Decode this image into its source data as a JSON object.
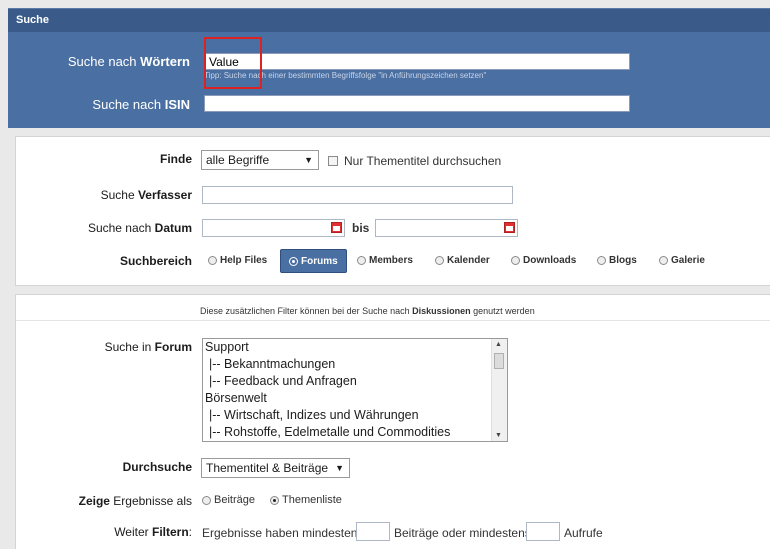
{
  "title": "Suche",
  "words": {
    "label_prefix": "Suche nach ",
    "label_bold": "Wörtern",
    "value": "Value",
    "tip": "Tipp: Suche nach einer bestimmten Begriffsfolge \"in Anführungszeichen setzen\""
  },
  "isin": {
    "label_prefix": "Suche nach ",
    "label_bold": "ISIN",
    "value": ""
  },
  "finde": {
    "label": "Finde",
    "selected": "alle Begriffe",
    "checkbox_label": "Nur Thementitel durchsuchen"
  },
  "verfasser": {
    "label_prefix": "Suche ",
    "label_bold": "Verfasser"
  },
  "datum": {
    "label_prefix": "Suche nach ",
    "label_bold": "Datum",
    "between": "bis"
  },
  "suchbereich": {
    "label": "Suchbereich",
    "options": [
      "Help Files",
      "Forums",
      "Members",
      "Kalender",
      "Downloads",
      "Blogs",
      "Galerie"
    ],
    "selected": "Forums"
  },
  "hint": {
    "prefix": "Diese zusätzlichen Filter können bei der Suche nach ",
    "bold": "Diskussionen",
    "suffix": " genutzt werden"
  },
  "forum": {
    "label_prefix": "Suche in ",
    "label_bold": "Forum",
    "items": [
      "Support",
      "|-- Bekanntmachungen",
      "|-- Feedback und Anfragen",
      "Börsenwelt",
      "|-- Wirtschaft, Indizes und Währungen",
      "|-- Rohstoffe, Edelmetalle und Commodities"
    ]
  },
  "durchsuche": {
    "label": "Durchsuche",
    "selected": "Thementitel & Beiträge"
  },
  "zeige": {
    "label_bold": "Zeige",
    "label_suffix": " Ergebnisse als",
    "options": [
      "Beiträge",
      "Themenliste"
    ],
    "selected": "Themenliste"
  },
  "filter": {
    "label_prefix": "Weiter ",
    "label_bold": "Filtern",
    "label_suffix": ":",
    "text1": "Ergebnisse haben mindestens",
    "text2": "Beiträge oder mindestens",
    "text3": "Aufrufe"
  },
  "colors": {
    "header": "#3a5b8a",
    "panel": "#4a6fa2",
    "highlight": "#dd2222"
  }
}
